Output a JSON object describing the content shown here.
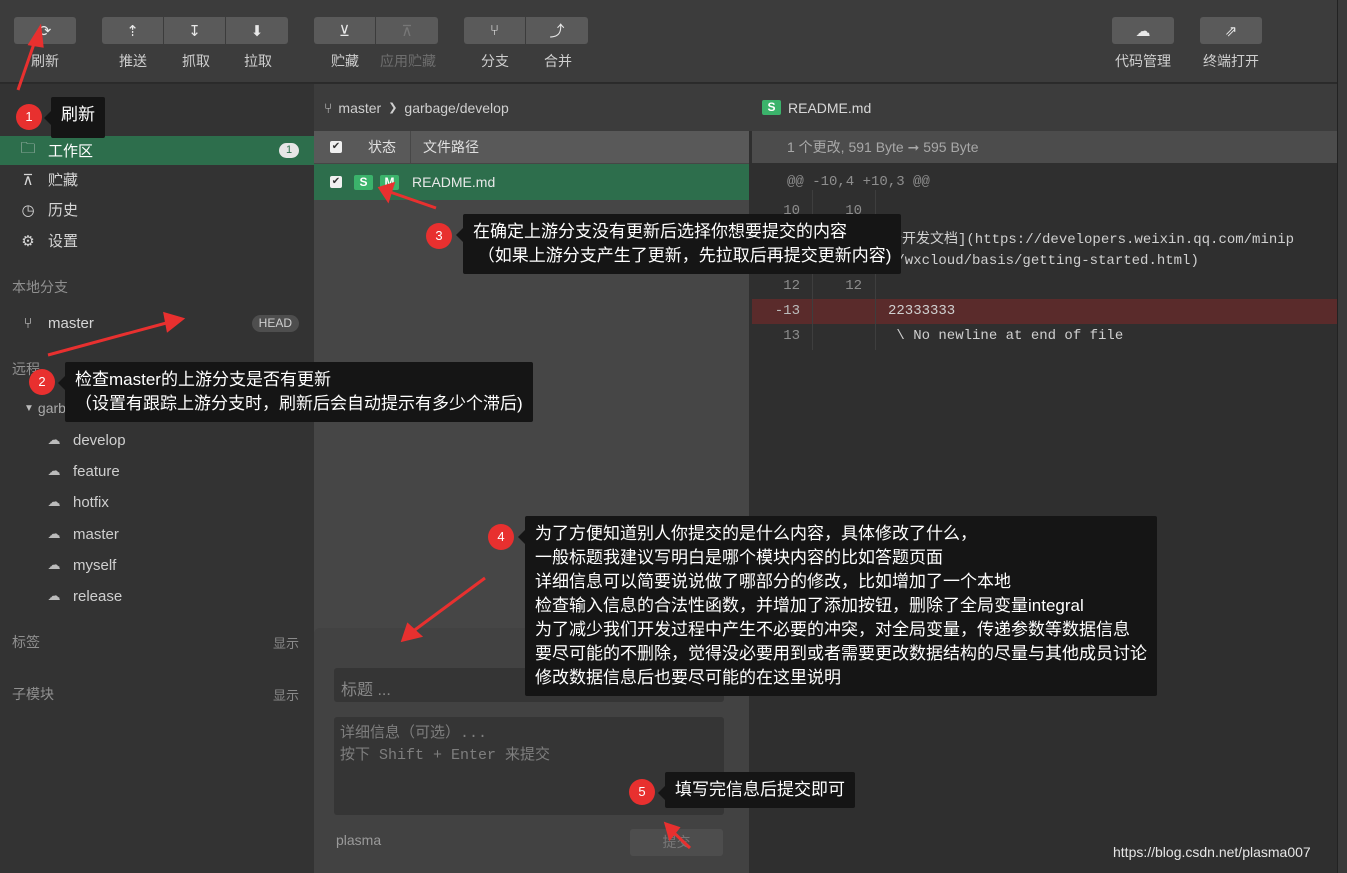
{
  "toolbar": {
    "refresh": "刷新",
    "push": "推送",
    "fetch": "抓取",
    "pull": "拉取",
    "stash": "贮藏",
    "apply_stash": "应用贮藏",
    "branch": "分支",
    "merge": "合并",
    "code_manage": "代码管理",
    "terminal": "终端打开"
  },
  "sidebar": {
    "workspace": {
      "label": "工作区",
      "count": "1"
    },
    "stash": "贮藏",
    "history": "历史",
    "settings": "设置",
    "local_branches_title": "本地分支",
    "local_branch": {
      "name": "master",
      "tag": "HEAD"
    },
    "remote_title": "远程",
    "remote_group": "garbage",
    "remote_branches": [
      "develop",
      "feature",
      "hotfix",
      "master",
      "myself",
      "release"
    ],
    "tags_title": "标签",
    "tags_show": "显示",
    "submodules_title": "子模块",
    "submodules_show": "显示"
  },
  "middle": {
    "breadcrumb_local": "master",
    "breadcrumb_remote": "garbage/develop",
    "col_status": "状态",
    "col_path": "文件路径",
    "file": {
      "tag1": "S",
      "tag2": "M",
      "path": "README.md"
    }
  },
  "commit": {
    "title_placeholder": "标题 ...",
    "body_placeholder": "详细信息（可选）...\n按下 Shift + Enter 来提交",
    "user": "plasma",
    "submit": "提交"
  },
  "diff": {
    "file_tag": "S",
    "file_name": "README.md",
    "info": "1 个更改, 591 Byte ➞ 595 Byte",
    "hunk": "@@ -10,4 +10,3 @@",
    "lines": [
      {
        "old": "10",
        "new": "10",
        "text": ""
      },
      {
        "old": "",
        "new": "",
        "text": "云开发文档](https://developers.weixin.qq.com/minip"
      },
      {
        "old": "",
        "new": "",
        "text": "v/wxcloud/basis/getting-started.html)"
      },
      {
        "old": "12",
        "new": "12",
        "text": ""
      },
      {
        "old": "-13",
        "new": "",
        "text": "22333333"
      },
      {
        "old": "13",
        "new": "",
        "text": " \\ No newline at end of file"
      }
    ]
  },
  "callouts": {
    "c1": "刷新",
    "c2": "检查master的上游分支是否有更新\n（设置有跟踪上游分支时，刷新后会自动提示有多少个滞后)",
    "c3": "在确定上游分支没有更新后选择你想要提交的内容\n （如果上游分支产生了更新，先拉取后再提交更新内容)",
    "c4": "为了方便知道别人你提交的是什么内容，具体修改了什么，\n一般标题我建议写明白是哪个模块内容的比如答题页面\n详细信息可以简要说说做了哪部分的修改，比如增加了一个本地\n检查输入信息的合法性函数，并增加了添加按钮，删除了全局变量integral\n为了减少我们开发过程中产生不必要的冲突，对全局变量，传递参数等数据信息\n要尽可能的不删除，觉得没必要用到或者需要更改数据结构的尽量与其他成员讨论\n修改数据信息后也要尽可能的在这里说明",
    "c5": "填写完信息后提交即可",
    "n1": "1",
    "n2": "2",
    "n3": "3",
    "n4": "4",
    "n5": "5"
  },
  "watermark": "https://blog.csdn.net/plasma007",
  "colors": {
    "accent_green": "#2d6e4c",
    "tag_green": "#3bb36b",
    "callout_bg": "#151515",
    "marker_red": "#e8302f",
    "deleted_line": "#5a2b2b"
  }
}
